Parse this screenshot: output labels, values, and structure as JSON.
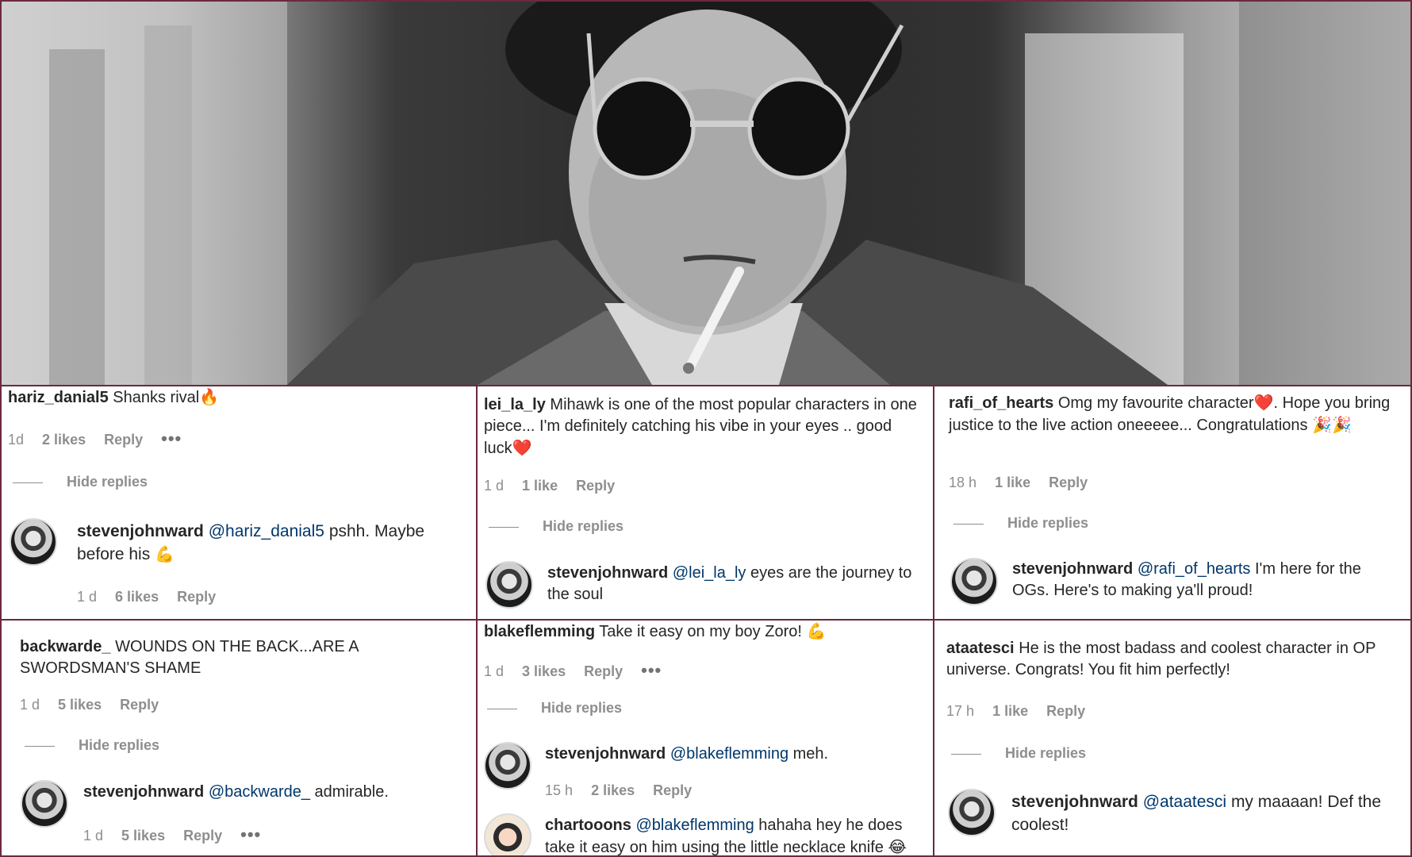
{
  "colors": {
    "border": "#6b2a3c",
    "text": "#262626",
    "muted": "#8e8e8e",
    "mention": "#00376b",
    "heart": "#e0245e"
  },
  "hero": {
    "description_icon": "portrait-photo"
  },
  "comments": [
    {
      "user": "hariz_danial5",
      "text": "Shanks rival",
      "emoji": "🔥",
      "time": "1d",
      "likes": "2 likes",
      "reply": "Reply",
      "more": "•••",
      "hide": "Hide replies",
      "reply_item": {
        "user": "stevenjohnward",
        "mention": "@hariz_danial5",
        "text": "pshh. Maybe before his",
        "emoji": "💪",
        "time": "1 d",
        "likes": "6 likes",
        "reply": "Reply"
      }
    },
    {
      "user": "lei_la_ly",
      "text": "Mihawk is one of the most popular characters in one piece... I'm definitely catching his vibe in your eyes .. good luck",
      "emoji": "❤️",
      "time": "1 d",
      "likes": "1 like",
      "reply": "Reply",
      "hide": "Hide replies",
      "reply_item": {
        "user": "stevenjohnward",
        "mention": "@lei_la_ly",
        "text": "eyes are the journey to the soul"
      }
    },
    {
      "user": "rafi_of_hearts",
      "text": "Omg my favourite character",
      "emoji": "❤️",
      "text2": ". Hope you bring justice to the live action oneeeee... Congratulations",
      "emoji2": "🎉🎉",
      "time": "18 h",
      "likes": "1 like",
      "reply": "Reply",
      "hide": "Hide replies",
      "reply_item": {
        "user": "stevenjohnward",
        "mention": "@rafi_of_hearts",
        "text": "I'm here for the OGs. Here's to making ya'll proud!"
      }
    },
    {
      "user": "backwarde_",
      "text": "WOUNDS ON THE BACK...ARE A SWORDSMAN'S SHAME",
      "time": "1 d",
      "likes": "5 likes",
      "reply": "Reply",
      "hide": "Hide replies",
      "reply_item": {
        "user": "stevenjohnward",
        "mention": "@backwarde_",
        "text": "admirable.",
        "time": "1 d",
        "likes": "5 likes",
        "reply": "Reply",
        "more": "•••"
      }
    },
    {
      "user": "blakeflemming",
      "text": "Take it easy on my boy Zoro!",
      "emoji": "💪",
      "time": "1 d",
      "likes": "3 likes",
      "reply": "Reply",
      "more": "•••",
      "hide": "Hide replies",
      "reply_item": {
        "user": "stevenjohnward",
        "mention": "@blakeflemming",
        "text": "meh.",
        "time": "15 h",
        "likes": "2 likes",
        "reply": "Reply"
      },
      "reply_item2": {
        "user": "chartooons",
        "mention": "@blakeflemming",
        "text": "hahaha hey he does take it easy on him using the little necklace knife",
        "emoji": "😂"
      }
    },
    {
      "user": "ataatesci",
      "text": "He is the most badass and coolest character in OP universe. Congrats! You fit him perfectly!",
      "time": "17 h",
      "likes": "1 like",
      "reply": "Reply",
      "hide": "Hide replies",
      "reply_item": {
        "user": "stevenjohnward",
        "mention": "@ataatesci",
        "text": "my maaaan! Def the coolest!"
      }
    }
  ]
}
